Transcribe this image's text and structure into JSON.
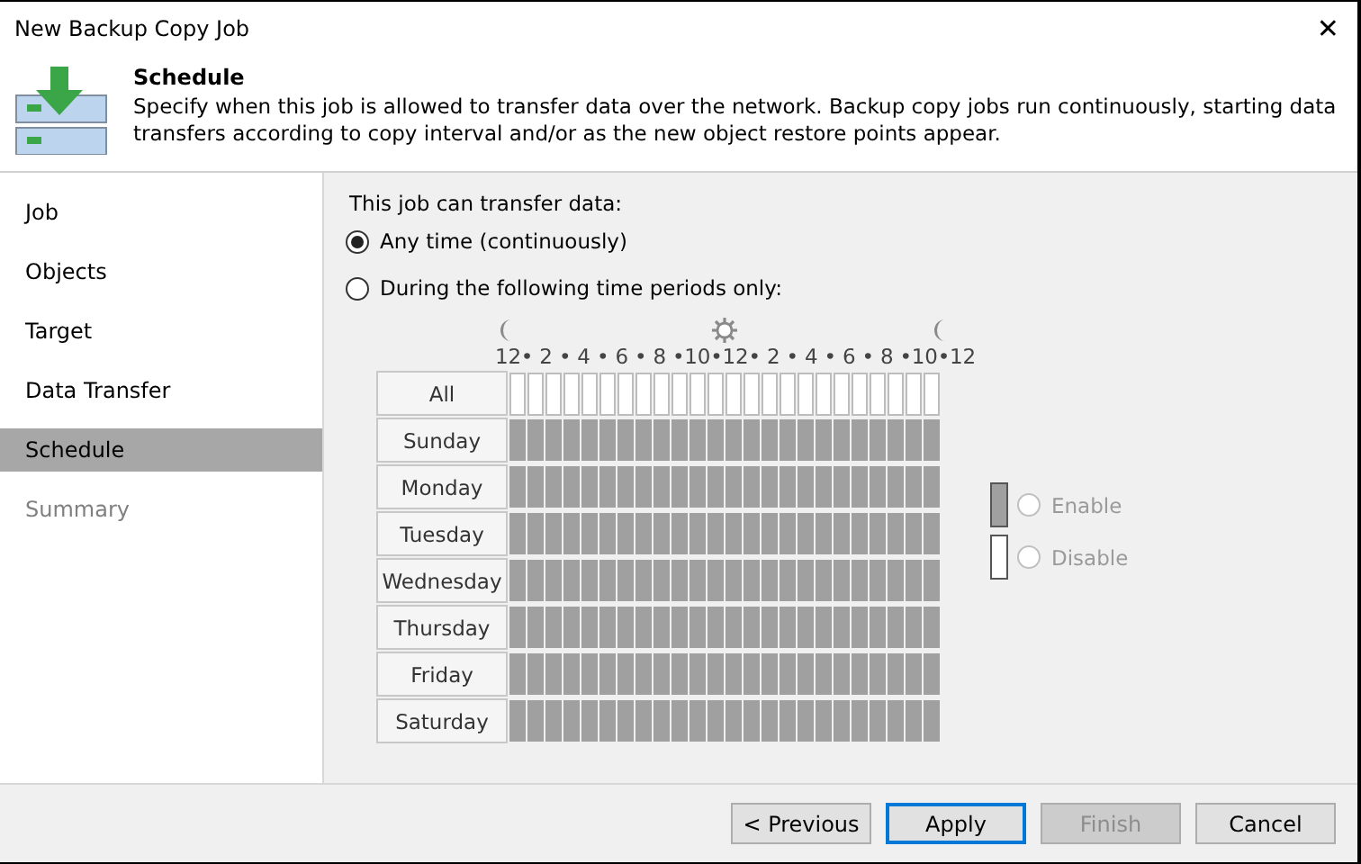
{
  "window": {
    "title": "New Backup Copy Job",
    "close": "✕"
  },
  "header": {
    "title": "Schedule",
    "description": "Specify when this job is allowed to transfer data over the network. Backup copy jobs run continuously, starting data transfers according to copy interval and/or as the new object restore points appear."
  },
  "sidebar": {
    "items": [
      {
        "label": "Job",
        "selected": false,
        "disabled": false
      },
      {
        "label": "Objects",
        "selected": false,
        "disabled": false
      },
      {
        "label": "Target",
        "selected": false,
        "disabled": false
      },
      {
        "label": "Data Transfer",
        "selected": false,
        "disabled": false
      },
      {
        "label": "Schedule",
        "selected": true,
        "disabled": false
      },
      {
        "label": "Summary",
        "selected": false,
        "disabled": true
      }
    ]
  },
  "schedule": {
    "prompt": "This job can transfer data:",
    "options": [
      {
        "label": "Any time (continuously)",
        "selected": true
      },
      {
        "label": "During the following time periods only:",
        "selected": false
      }
    ],
    "hour_scale": "12• 2 • 4 • 6 • 8 •10•12• 2 • 4 • 6 • 8 •10•12",
    "all_label": "All",
    "days": [
      {
        "label": "Sunday",
        "hours": [
          true,
          true,
          true,
          true,
          true,
          true,
          true,
          true,
          true,
          true,
          true,
          true,
          true,
          true,
          true,
          true,
          true,
          true,
          true,
          true,
          true,
          true,
          true,
          true
        ]
      },
      {
        "label": "Monday",
        "hours": [
          true,
          true,
          true,
          true,
          true,
          true,
          true,
          true,
          true,
          true,
          true,
          true,
          true,
          true,
          true,
          true,
          true,
          true,
          true,
          true,
          true,
          true,
          true,
          true
        ]
      },
      {
        "label": "Tuesday",
        "hours": [
          true,
          true,
          true,
          true,
          true,
          true,
          true,
          true,
          true,
          true,
          true,
          true,
          true,
          true,
          true,
          true,
          true,
          true,
          true,
          true,
          true,
          true,
          true,
          true
        ]
      },
      {
        "label": "Wednesday",
        "hours": [
          true,
          true,
          true,
          true,
          true,
          true,
          true,
          true,
          true,
          true,
          true,
          true,
          true,
          true,
          true,
          true,
          true,
          true,
          true,
          true,
          true,
          true,
          true,
          true
        ]
      },
      {
        "label": "Thursday",
        "hours": [
          true,
          true,
          true,
          true,
          true,
          true,
          true,
          true,
          true,
          true,
          true,
          true,
          true,
          true,
          true,
          true,
          true,
          true,
          true,
          true,
          true,
          true,
          true,
          true
        ]
      },
      {
        "label": "Friday",
        "hours": [
          true,
          true,
          true,
          true,
          true,
          true,
          true,
          true,
          true,
          true,
          true,
          true,
          true,
          true,
          true,
          true,
          true,
          true,
          true,
          true,
          true,
          true,
          true,
          true
        ]
      },
      {
        "label": "Saturday",
        "hours": [
          true,
          true,
          true,
          true,
          true,
          true,
          true,
          true,
          true,
          true,
          true,
          true,
          true,
          true,
          true,
          true,
          true,
          true,
          true,
          true,
          true,
          true,
          true,
          true
        ]
      }
    ],
    "legend": [
      {
        "label": "Enable",
        "kind": "enable",
        "selected": false,
        "disabled": true
      },
      {
        "label": "Disable",
        "kind": "disable",
        "selected": false,
        "disabled": true
      }
    ]
  },
  "buttons": [
    {
      "label": "< Previous",
      "default": false,
      "disabled": false
    },
    {
      "label": "Apply",
      "default": true,
      "disabled": false
    },
    {
      "label": "Finish",
      "default": false,
      "disabled": true
    },
    {
      "label": "Cancel",
      "default": false,
      "disabled": false
    }
  ]
}
